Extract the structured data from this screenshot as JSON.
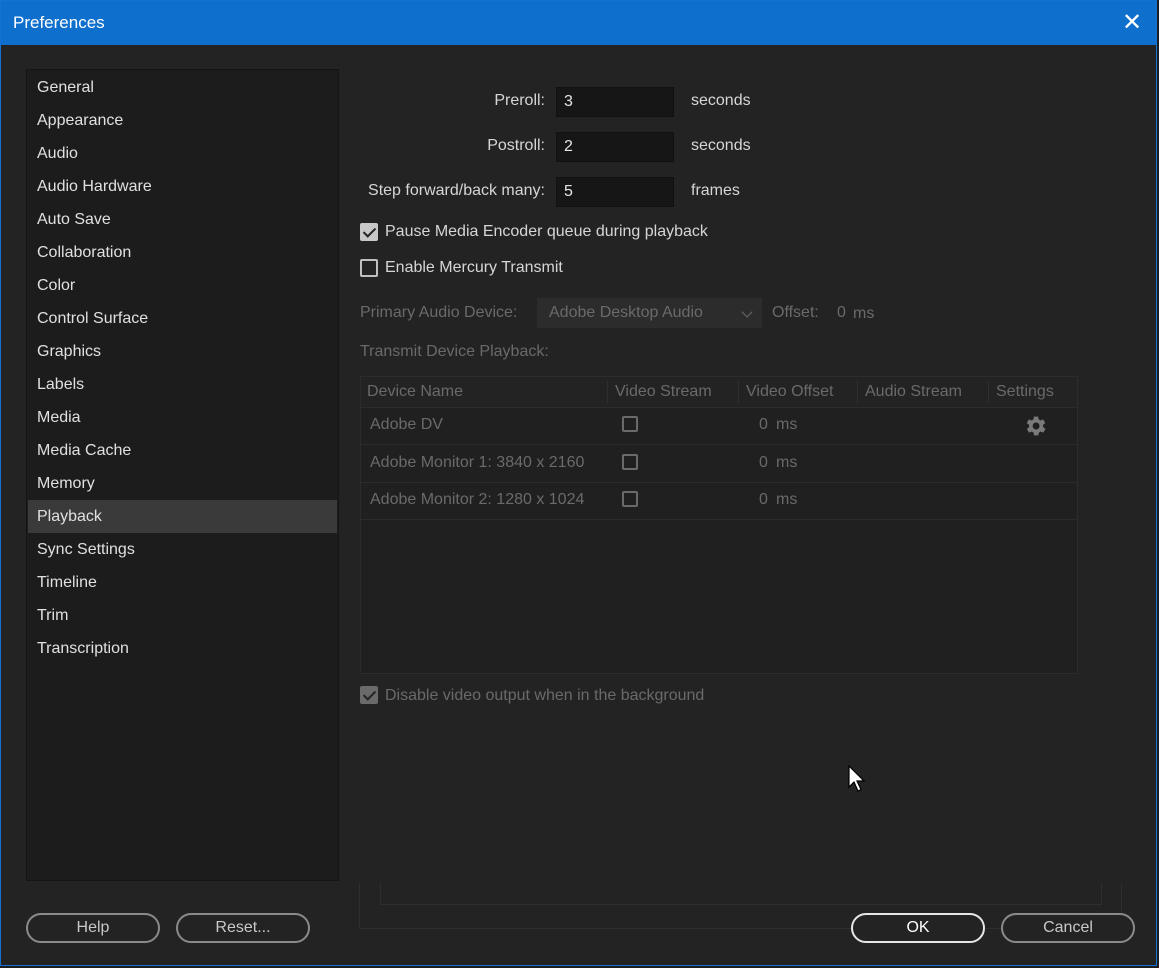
{
  "window": {
    "title": "Preferences"
  },
  "sidebar": {
    "items": [
      {
        "label": "General"
      },
      {
        "label": "Appearance"
      },
      {
        "label": "Audio"
      },
      {
        "label": "Audio Hardware"
      },
      {
        "label": "Auto Save"
      },
      {
        "label": "Collaboration"
      },
      {
        "label": "Color"
      },
      {
        "label": "Control Surface"
      },
      {
        "label": "Graphics"
      },
      {
        "label": "Labels"
      },
      {
        "label": "Media"
      },
      {
        "label": "Media Cache"
      },
      {
        "label": "Memory"
      },
      {
        "label": "Playback"
      },
      {
        "label": "Sync Settings"
      },
      {
        "label": "Timeline"
      },
      {
        "label": "Trim"
      },
      {
        "label": "Transcription"
      }
    ],
    "selected": "Playback"
  },
  "playback": {
    "preroll": {
      "label": "Preroll:",
      "value": "3",
      "unit": "seconds"
    },
    "postroll": {
      "label": "Postroll:",
      "value": "2",
      "unit": "seconds"
    },
    "step": {
      "label": "Step forward/back many:",
      "value": "5",
      "unit": "frames"
    },
    "pause_encoder": {
      "label": "Pause Media Encoder queue during playback",
      "checked": true
    },
    "mercury": {
      "label": "Enable Mercury Transmit",
      "checked": false
    },
    "audio_device": {
      "label": "Primary Audio Device:",
      "value": "Adobe Desktop Audio",
      "offset_label": "Offset:",
      "offset_value": "0",
      "offset_unit": "ms"
    },
    "transmit_label": "Transmit Device Playback:",
    "table": {
      "headers": [
        "Device Name",
        "Video Stream",
        "Video Offset",
        "Audio Stream",
        "Settings"
      ],
      "rows": [
        {
          "name": "Adobe DV",
          "offset": "0",
          "unit": "ms",
          "has_settings": true
        },
        {
          "name": "Adobe Monitor 1: 3840 x 2160",
          "offset": "0",
          "unit": "ms",
          "has_settings": false
        },
        {
          "name": "Adobe Monitor 2: 1280 x 1024",
          "offset": "0",
          "unit": "ms",
          "has_settings": false
        }
      ]
    },
    "disable_bg": {
      "label": "Disable video output when in the background",
      "checked": true
    }
  },
  "buttons": {
    "help": "Help",
    "reset": "Reset...",
    "ok": "OK",
    "cancel": "Cancel"
  },
  "icons": {
    "close": "close-icon",
    "gear": "gear-icon",
    "cursor": "mouse-cursor-icon"
  },
  "colors": {
    "title_bar": "#0f6fcc",
    "background": "#232323"
  }
}
